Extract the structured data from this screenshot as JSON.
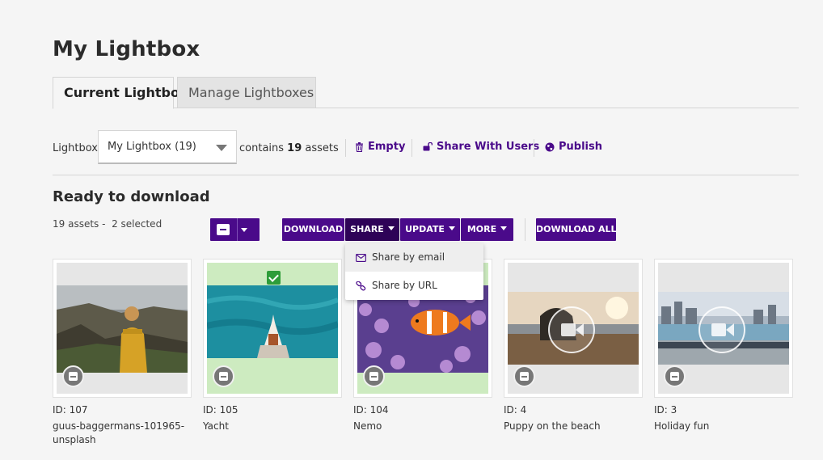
{
  "page": {
    "title": "My Lightbox"
  },
  "tabs": [
    {
      "label": "Current Lightbox",
      "active": true
    },
    {
      "label": "Manage Lightboxes",
      "active": false
    }
  ],
  "lightbox_bar": {
    "label": "Lightbox:",
    "selected": "My Lightbox (19)",
    "contains_prefix": "contains",
    "contains_count": "19",
    "contains_suffix": "assets",
    "actions": {
      "empty": "Empty",
      "share_with_users": "Share With Users",
      "publish": "Publish"
    }
  },
  "download_section": {
    "title": "Ready to download",
    "assets_count": "19 assets -",
    "selected_count": "2 selected"
  },
  "toolbar": {
    "download": "DOWNLOAD",
    "share": "SHARE",
    "update": "UPDATE",
    "more": "MORE",
    "download_all": "DOWNLOAD ALL"
  },
  "share_menu": {
    "items": [
      "Share by email",
      "Share by URL"
    ]
  },
  "assets": [
    {
      "id_label": "ID: 107",
      "name": "guus-baggermans-101965-unsplash",
      "selected": false,
      "type": "image"
    },
    {
      "id_label": "ID: 105",
      "name": "Yacht",
      "selected": true,
      "type": "image"
    },
    {
      "id_label": "ID: 104",
      "name": "Nemo",
      "selected": true,
      "type": "image"
    },
    {
      "id_label": "ID: 4",
      "name": "Puppy on the beach",
      "selected": false,
      "type": "video"
    },
    {
      "id_label": "ID: 3",
      "name": "Holiday fun",
      "selected": false,
      "type": "video"
    }
  ],
  "colors": {
    "accent": "#4a0a8a",
    "accent_dark": "#2e0357",
    "selected_bg": "#cdebc0",
    "check_green": "#2e9d3a"
  },
  "icons": {
    "empty": "trash-icon",
    "share_with_users": "unlock-icon",
    "publish": "globe-icon",
    "share_email": "envelope-icon",
    "share_url": "link-icon",
    "video": "video-camera-icon",
    "remove": "remove-from-lightbox-icon"
  }
}
